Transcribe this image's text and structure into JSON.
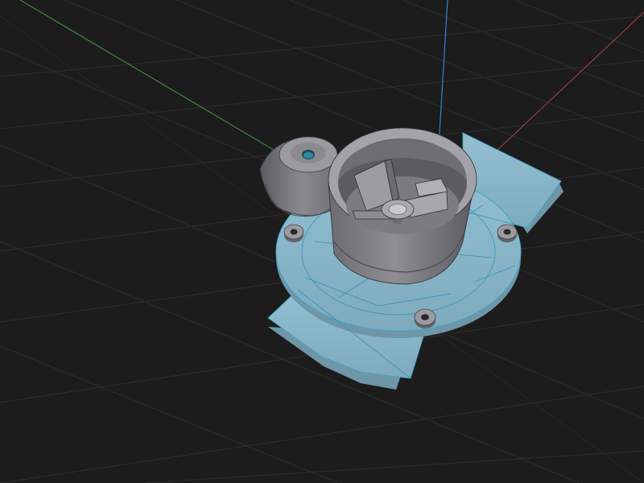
{
  "viewport": {
    "background": "#1c1c1c",
    "grid_color": "#2e2e2e"
  },
  "axes": {
    "x_color": "#b2413c",
    "y_color": "#4a9a4a",
    "z_color": "#3a7fd6"
  },
  "model": {
    "selected_color": "#8ab7cb",
    "selected_edge_color": "#3fa7c9",
    "unselected_color": "#808084",
    "unselected_dark": "#4d4d52",
    "wire_color": "#2a8fb5"
  }
}
